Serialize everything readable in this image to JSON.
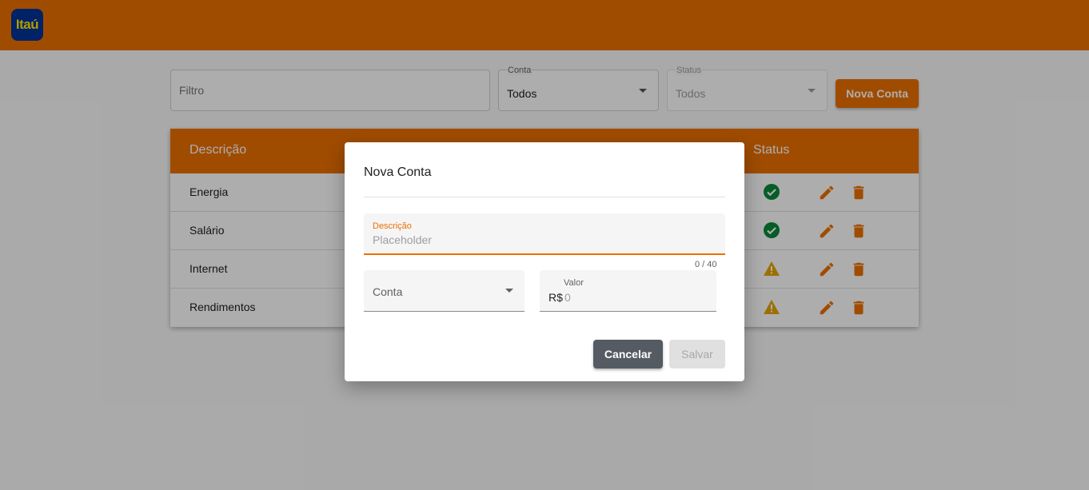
{
  "brand": {
    "logo_text": "Itaú"
  },
  "filters": {
    "filtro_placeholder": "Filtro",
    "conta_label": "Conta",
    "conta_value": "Todos",
    "status_label": "Status",
    "status_value": "Todos",
    "nova_conta_label": "Nova Conta"
  },
  "table": {
    "headers": {
      "descricao": "Descrição",
      "status": "Status"
    },
    "rows": [
      {
        "descricao": "Energia",
        "status": "paid-check-icon"
      },
      {
        "descricao": "Salário",
        "status": "paid-check-icon"
      },
      {
        "descricao": "Internet",
        "status": "warning-icon"
      },
      {
        "descricao": "Rendimentos",
        "status": "warning-icon"
      }
    ]
  },
  "dialog": {
    "title": "Nova Conta",
    "descricao_label": "Descrição",
    "descricao_placeholder": "Placeholder",
    "descricao_counter": "0 / 40",
    "conta_placeholder": "Conta",
    "valor_label": "Valor",
    "valor_prefix": "R$",
    "valor_value": "0",
    "cancel_label": "Cancelar",
    "save_label": "Salvar"
  },
  "colors": {
    "brand_orange": "#ec7000",
    "brand_blue": "#003399",
    "brand_yellow": "#ffe600",
    "success_green": "#0a8a3a",
    "warning_amber": "#e8a400",
    "cancel_gray": "#545b62"
  }
}
